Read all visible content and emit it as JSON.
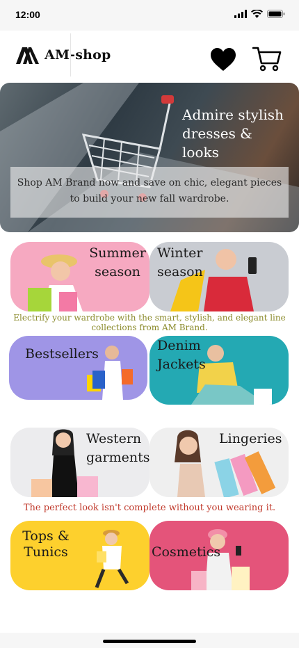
{
  "status": {
    "time": "12:00"
  },
  "header": {
    "brand": "AM-shop"
  },
  "hero": {
    "title": "Admire stylish dresses & looks",
    "subtitle": "Shop AM Brand now and save on chic, elegant pieces to build your new fall wardrobe."
  },
  "categories": [
    {
      "label": "Summer season",
      "color": "#f6a9c1"
    },
    {
      "label": "Winter season",
      "color": "#c9ccd2"
    },
    {
      "label": "Bestsellers",
      "color": "#9f95e6"
    },
    {
      "label": "Denim Jackets",
      "color": "#24a9b3"
    },
    {
      "label": "Western garments",
      "color": "#ececee"
    },
    {
      "label": "Lingeries",
      "color": "#efefef"
    },
    {
      "label": "Tops & Tunics",
      "color": "#fdd02d"
    },
    {
      "label": "Cosmetics",
      "color": "#e4547a"
    }
  ],
  "taglines": {
    "one": "Electrify your wardrobe with the smart, stylish, and elegant line collections from AM Brand.",
    "one_color": "#8a8a2a",
    "two": "The perfect look isn't complete without you wearing it.",
    "two_color": "#c0392b"
  }
}
